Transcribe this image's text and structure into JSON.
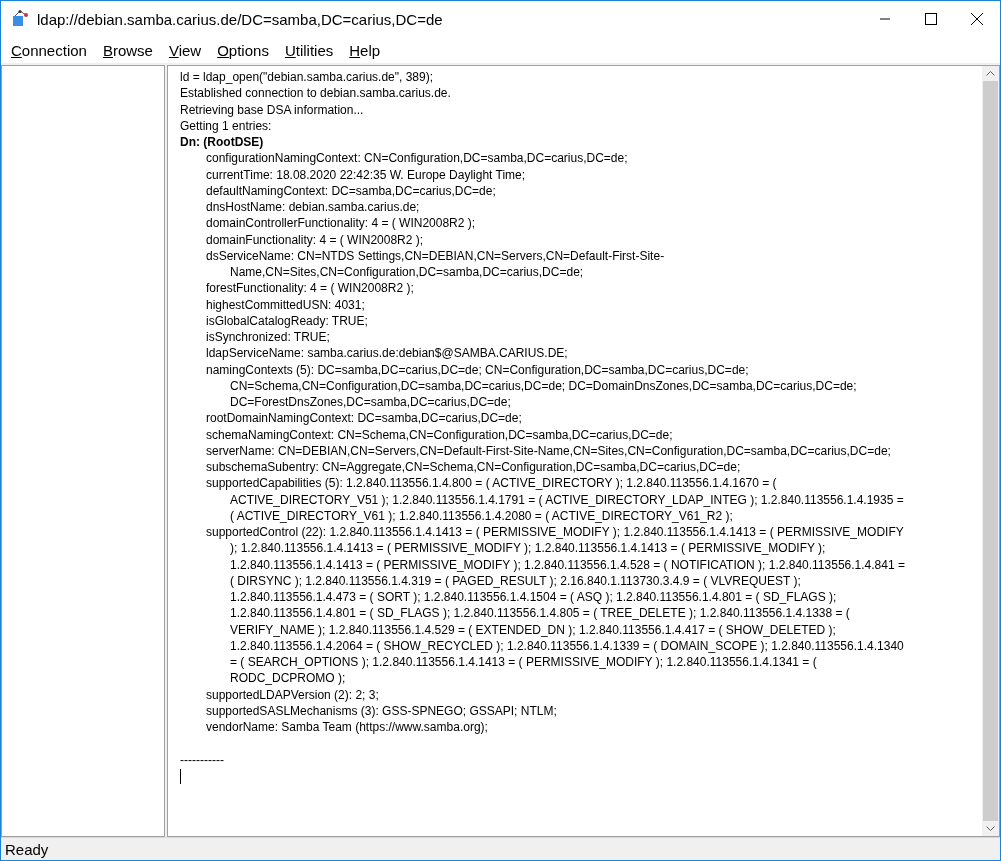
{
  "window": {
    "title": "ldap://debian.samba.carius.de/DC=samba,DC=carius,DC=de"
  },
  "menu": [
    {
      "access_key": "C",
      "rest": "onnection"
    },
    {
      "access_key": "B",
      "rest": "rowse"
    },
    {
      "access_key": "V",
      "rest": "iew"
    },
    {
      "access_key": "O",
      "rest": "ptions"
    },
    {
      "access_key": "U",
      "rest": "tilities"
    },
    {
      "access_key": "H",
      "rest": "elp"
    }
  ],
  "output": [
    {
      "kind": "plain",
      "text": "ld = ldap_open(\"debian.samba.carius.de\", 389);"
    },
    {
      "kind": "plain",
      "text": "Established connection to debian.samba.carius.de."
    },
    {
      "kind": "plain",
      "text": "Retrieving base DSA information..."
    },
    {
      "kind": "plain",
      "text": "Getting 1 entries:"
    },
    {
      "kind": "heading",
      "text": "Dn: (RootDSE)"
    },
    {
      "kind": "attribute",
      "text": "configurationNamingContext: CN=Configuration,DC=samba,DC=carius,DC=de;"
    },
    {
      "kind": "attribute",
      "text": "currentTime: 18.08.2020 22:42:35 W. Europe Daylight Time;"
    },
    {
      "kind": "attribute",
      "text": "defaultNamingContext: DC=samba,DC=carius,DC=de;"
    },
    {
      "kind": "attribute",
      "text": "dnsHostName: debian.samba.carius.de;"
    },
    {
      "kind": "attribute",
      "text": "domainControllerFunctionality: 4 = ( WIN2008R2 );"
    },
    {
      "kind": "attribute",
      "text": "domainFunctionality: 4 = ( WIN2008R2 );"
    },
    {
      "kind": "attribute",
      "text": "dsServiceName: CN=NTDS Settings,CN=DEBIAN,CN=Servers,CN=Default-First-Site-"
    },
    {
      "kind": "wrapped",
      "text": "Name,CN=Sites,CN=Configuration,DC=samba,DC=carius,DC=de;"
    },
    {
      "kind": "attribute",
      "text": "forestFunctionality: 4 = ( WIN2008R2 );"
    },
    {
      "kind": "attribute",
      "text": "highestCommittedUSN: 4031;"
    },
    {
      "kind": "attribute",
      "text": "isGlobalCatalogReady: TRUE;"
    },
    {
      "kind": "attribute",
      "text": "isSynchronized: TRUE;"
    },
    {
      "kind": "attribute",
      "text": "ldapServiceName: samba.carius.de:debian$@SAMBA.CARIUS.DE;"
    },
    {
      "kind": "attribute",
      "text": "namingContexts (5): DC=samba,DC=carius,DC=de; CN=Configuration,DC=samba,DC=carius,DC=de;"
    },
    {
      "kind": "wrapped",
      "text": "CN=Schema,CN=Configuration,DC=samba,DC=carius,DC=de; DC=DomainDnsZones,DC=samba,DC=carius,DC=de;"
    },
    {
      "kind": "wrapped",
      "text": "DC=ForestDnsZones,DC=samba,DC=carius,DC=de;"
    },
    {
      "kind": "attribute",
      "text": "rootDomainNamingContext: DC=samba,DC=carius,DC=de;"
    },
    {
      "kind": "attribute",
      "text": "schemaNamingContext: CN=Schema,CN=Configuration,DC=samba,DC=carius,DC=de;"
    },
    {
      "kind": "attribute",
      "text": "serverName: CN=DEBIAN,CN=Servers,CN=Default-First-Site-Name,CN=Sites,CN=Configuration,DC=samba,DC=carius,DC=de;"
    },
    {
      "kind": "attribute",
      "text": "subschemaSubentry: CN=Aggregate,CN=Schema,CN=Configuration,DC=samba,DC=carius,DC=de;"
    },
    {
      "kind": "attribute",
      "text": "supportedCapabilities (5): 1.2.840.113556.1.4.800 = ( ACTIVE_DIRECTORY ); 1.2.840.113556.1.4.1670 = ("
    },
    {
      "kind": "wrapped",
      "text": "ACTIVE_DIRECTORY_V51 ); 1.2.840.113556.1.4.1791 = ( ACTIVE_DIRECTORY_LDAP_INTEG ); 1.2.840.113556.1.4.1935 ="
    },
    {
      "kind": "wrapped",
      "text": "( ACTIVE_DIRECTORY_V61 ); 1.2.840.113556.1.4.2080 = ( ACTIVE_DIRECTORY_V61_R2 );"
    },
    {
      "kind": "attribute",
      "text": "supportedControl (22): 1.2.840.113556.1.4.1413 = ( PERMISSIVE_MODIFY ); 1.2.840.113556.1.4.1413 = ( PERMISSIVE_MODIFY"
    },
    {
      "kind": "wrapped",
      "text": "); 1.2.840.113556.1.4.1413 = ( PERMISSIVE_MODIFY ); 1.2.840.113556.1.4.1413 = ( PERMISSIVE_MODIFY );"
    },
    {
      "kind": "wrapped",
      "text": "1.2.840.113556.1.4.1413 = ( PERMISSIVE_MODIFY ); 1.2.840.113556.1.4.528 = ( NOTIFICATION ); 1.2.840.113556.1.4.841 ="
    },
    {
      "kind": "wrapped",
      "text": "( DIRSYNC ); 1.2.840.113556.1.4.319 = ( PAGED_RESULT ); 2.16.840.1.113730.3.4.9 = ( VLVREQUEST );"
    },
    {
      "kind": "wrapped",
      "text": "1.2.840.113556.1.4.473 = ( SORT ); 1.2.840.113556.1.4.1504 = ( ASQ ); 1.2.840.113556.1.4.801 = ( SD_FLAGS );"
    },
    {
      "kind": "wrapped",
      "text": "1.2.840.113556.1.4.801 = ( SD_FLAGS ); 1.2.840.113556.1.4.805 = ( TREE_DELETE ); 1.2.840.113556.1.4.1338 = ("
    },
    {
      "kind": "wrapped",
      "text": "VERIFY_NAME ); 1.2.840.113556.1.4.529 = ( EXTENDED_DN ); 1.2.840.113556.1.4.417 = ( SHOW_DELETED );"
    },
    {
      "kind": "wrapped",
      "text": "1.2.840.113556.1.4.2064 = ( SHOW_RECYCLED ); 1.2.840.113556.1.4.1339 = ( DOMAIN_SCOPE ); 1.2.840.113556.1.4.1340"
    },
    {
      "kind": "wrapped",
      "text": "= ( SEARCH_OPTIONS ); 1.2.840.113556.1.4.1413 = ( PERMISSIVE_MODIFY ); 1.2.840.113556.1.4.1341 = ("
    },
    {
      "kind": "wrapped",
      "text": "RODC_DCPROMO );"
    },
    {
      "kind": "attribute",
      "text": "supportedLDAPVersion (2): 2; 3;"
    },
    {
      "kind": "attribute",
      "text": "supportedSASLMechanisms (3): GSS-SPNEGO; GSSAPI; NTLM;"
    },
    {
      "kind": "attribute",
      "text": "vendorName: Samba Team (https://www.samba.org);"
    },
    {
      "kind": "blank"
    },
    {
      "kind": "plain",
      "text": "-----------"
    }
  ],
  "status_bar": {
    "text": "Ready"
  }
}
